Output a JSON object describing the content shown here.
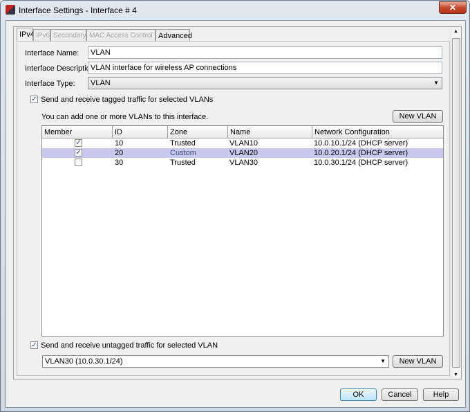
{
  "window": {
    "title": "Interface Settings - Interface # 4",
    "close": "✕"
  },
  "tabs": [
    {
      "label": "IPv4"
    },
    {
      "label": "IPv6"
    },
    {
      "label": "Secondary"
    },
    {
      "label": "MAC Access Control"
    },
    {
      "label": "Advanced"
    }
  ],
  "form": {
    "name_label": "Interface Name:",
    "name_value": "VLAN",
    "desc_label": "Interface Description:",
    "desc_value": "VLAN interface for wireless AP connections",
    "type_label": "Interface Type:",
    "type_value": "VLAN"
  },
  "tagged": {
    "checked": true,
    "label": "Send and receive tagged traffic for selected VLANs",
    "hint": "You can add one or more VLANs to this interface.",
    "new_vlan": "New VLAN"
  },
  "table": {
    "headers": [
      "Member",
      "ID",
      "Zone",
      "Name",
      "Network Configuration"
    ],
    "rows": [
      {
        "member": true,
        "id": "10",
        "zone": "Trusted",
        "name": "VLAN10",
        "network": "10.0.10.1/24 (DHCP server)"
      },
      {
        "member": true,
        "id": "20",
        "zone": "Custom",
        "name": "VLAN20",
        "network": "10.0.20.1/24 (DHCP server)"
      },
      {
        "member": false,
        "id": "30",
        "zone": "Trusted",
        "name": "VLAN30",
        "network": "10.0.30.1/24 (DHCP server)"
      }
    ]
  },
  "untagged": {
    "checked": true,
    "label": "Send and receive untagged traffic for selected VLAN",
    "selected": "VLAN30 (10.0.30.1/24)",
    "new_vlan": "New VLAN"
  },
  "buttons": {
    "ok": "OK",
    "cancel": "Cancel",
    "help": "Help"
  }
}
